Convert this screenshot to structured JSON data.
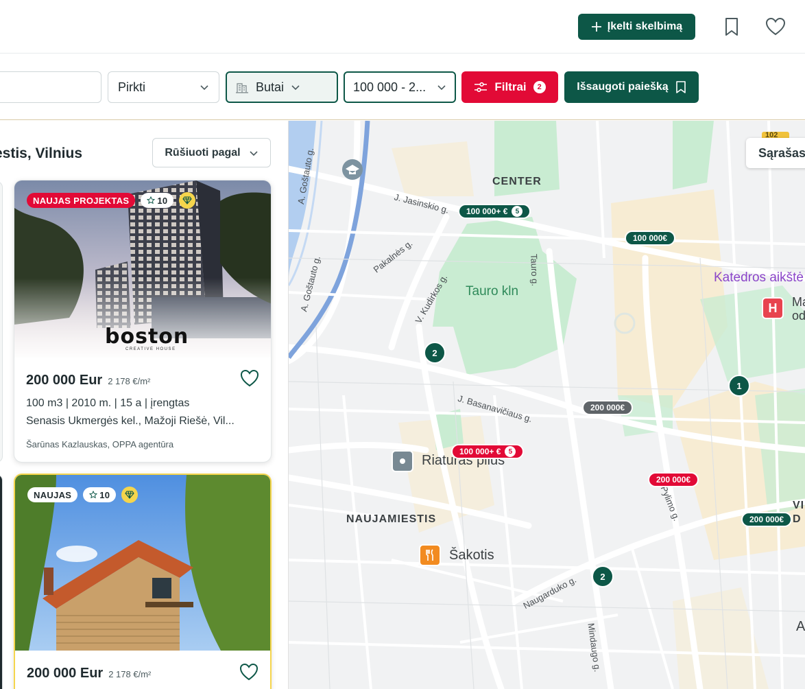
{
  "header": {
    "post_ad_label": "Įkelti skelbimą"
  },
  "filters": {
    "deal_type": "Pirkti",
    "property_type": "Butai",
    "price_range": "100 000 - 2...",
    "filters_label": "Filtrai",
    "filters_count": "2",
    "save_search_label": "Išsaugoti paiešką"
  },
  "listings": {
    "location_title": "estis, Vilnius",
    "sort_label": "Rūšiuoti pagal",
    "cards": [
      {
        "tag": "NAUJAS PROJEKTAS",
        "rating": "10",
        "brand": "boston",
        "brand_sub": "CREATIVE HOUSE",
        "price": "200 000 Eur",
        "price_per_m2": "2 178 €/m²",
        "meta": "100 m3  |  2010 m.  |  15 a  |  įrengtas",
        "address": "Senasis Ukmergės kel., Mažoji Riešė, Vil...",
        "agent": "Šarūnas Kazlauskas, OPPA agentūra"
      },
      {
        "tag": "NAUJAS",
        "rating": "10",
        "price": "200 000 Eur",
        "price_per_m2": "2 178 €/m²"
      }
    ]
  },
  "map": {
    "list_toggle": "Sąrašas",
    "areas": [
      "CENTER",
      "NAUJAMIESTIS",
      "VIL",
      "D"
    ],
    "streets": [
      "A. Goštauto g.",
      "J. Jasinskio g.",
      "Pakalnės g.",
      "V. Kudirkos g.",
      "Tauro g.",
      "J. Basanavičiaus g.",
      "Naugarduko g.",
      "Mindaugo g.",
      "Pylimo g.",
      "A. Goštauto g."
    ],
    "park": "Tauro kln",
    "places": {
      "katedros": "Katedros aikštė",
      "riaturas": "Riaturas plius",
      "sakotis": "Šakotis",
      "hospital_line1": "Ma",
      "hospital_line2": "od",
      "ausros": "Aušro",
      "road_badge": "102"
    },
    "pins": [
      {
        "label": "100 000+ €",
        "count": "5"
      },
      {
        "label": "100 000€"
      },
      {
        "label": "200 000€"
      },
      {
        "label": "100 000+ €",
        "count": "5"
      },
      {
        "label": "200 000€"
      },
      {
        "label": "200 000€"
      }
    ],
    "clusters": [
      "2",
      "1",
      "2"
    ]
  },
  "colors": {
    "brand_green": "#0d5747",
    "accent_red": "#e20a36",
    "gem_yellow": "#f5d54c"
  }
}
